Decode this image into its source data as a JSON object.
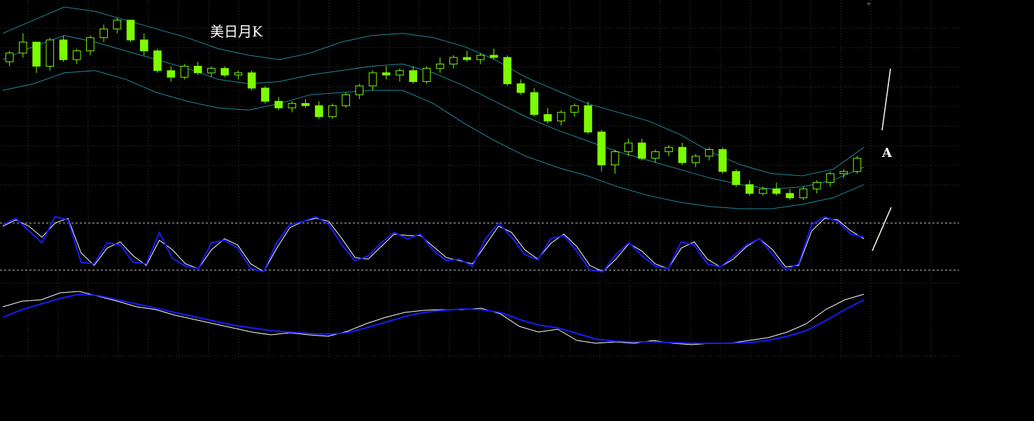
{
  "chart_data": {
    "type": "candlestick",
    "title": "美日月K",
    "annotation": "A",
    "grid": true,
    "colors": {
      "background": "#000000",
      "candle": "#7CFC00",
      "bollinger": "#1f8a9a",
      "fast_line": "#ffffff",
      "slow_line": "#1a1aff",
      "grid": "#3a3a3a",
      "annotation": "#ffffff"
    },
    "panels": [
      {
        "name": "",
        "type": "candlestick_bollinger",
        "ylim": [
          0,
          1
        ]
      },
      {
        "name": "",
        "type": "oscillator",
        "ylim": [
          0,
          100
        ],
        "reference_levels": [
          80,
          20
        ]
      },
      {
        "name": "",
        "type": "oscillator",
        "ylim": [
          0,
          100
        ]
      }
    ],
    "candles": [
      [
        0.35,
        0.4,
        0.33,
        0.39
      ],
      [
        0.39,
        0.48,
        0.37,
        0.44
      ],
      [
        0.44,
        0.42,
        0.3,
        0.33
      ],
      [
        0.33,
        0.46,
        0.31,
        0.45
      ],
      [
        0.45,
        0.47,
        0.35,
        0.36
      ],
      [
        0.36,
        0.41,
        0.34,
        0.4
      ],
      [
        0.4,
        0.47,
        0.38,
        0.46
      ],
      [
        0.46,
        0.52,
        0.44,
        0.5
      ],
      [
        0.5,
        0.55,
        0.48,
        0.54
      ],
      [
        0.54,
        0.53,
        0.44,
        0.45
      ],
      [
        0.45,
        0.48,
        0.38,
        0.4
      ],
      [
        0.4,
        0.41,
        0.3,
        0.31
      ],
      [
        0.31,
        0.33,
        0.26,
        0.28
      ],
      [
        0.28,
        0.34,
        0.27,
        0.33
      ],
      [
        0.33,
        0.35,
        0.29,
        0.3
      ],
      [
        0.3,
        0.33,
        0.28,
        0.32
      ],
      [
        0.32,
        0.33,
        0.28,
        0.29
      ],
      [
        0.29,
        0.31,
        0.27,
        0.3
      ],
      [
        0.3,
        0.31,
        0.22,
        0.23
      ],
      [
        0.23,
        0.24,
        0.16,
        0.17
      ],
      [
        0.17,
        0.19,
        0.13,
        0.14
      ],
      [
        0.14,
        0.17,
        0.12,
        0.16
      ],
      [
        0.16,
        0.18,
        0.14,
        0.15
      ],
      [
        0.15,
        0.17,
        0.09,
        0.1
      ],
      [
        0.1,
        0.16,
        0.09,
        0.15
      ],
      [
        0.15,
        0.21,
        0.14,
        0.2
      ],
      [
        0.2,
        0.25,
        0.18,
        0.24
      ],
      [
        0.24,
        0.31,
        0.22,
        0.3
      ],
      [
        0.3,
        0.33,
        0.27,
        0.29
      ],
      [
        0.29,
        0.32,
        0.26,
        0.31
      ],
      [
        0.31,
        0.33,
        0.25,
        0.26
      ],
      [
        0.26,
        0.33,
        0.25,
        0.32
      ],
      [
        0.32,
        0.37,
        0.3,
        0.34
      ],
      [
        0.34,
        0.38,
        0.32,
        0.37
      ],
      [
        0.37,
        0.4,
        0.35,
        0.36
      ],
      [
        0.36,
        0.39,
        0.34,
        0.38
      ],
      [
        0.38,
        0.41,
        0.36,
        0.37
      ],
      [
        0.37,
        0.38,
        0.24,
        0.25
      ],
      [
        0.25,
        0.27,
        0.2,
        0.21
      ],
      [
        0.21,
        0.23,
        0.1,
        0.11
      ],
      [
        0.11,
        0.14,
        0.07,
        0.08
      ],
      [
        0.08,
        0.13,
        0.06,
        0.12
      ],
      [
        0.12,
        0.16,
        0.1,
        0.15
      ],
      [
        0.15,
        0.17,
        0.02,
        0.03
      ],
      [
        0.03,
        0.04,
        -0.15,
        -0.12
      ],
      [
        -0.12,
        -0.05,
        -0.16,
        -0.06
      ],
      [
        -0.06,
        0.0,
        -0.08,
        -0.02
      ],
      [
        -0.02,
        0.0,
        -0.1,
        -0.09
      ],
      [
        -0.09,
        -0.05,
        -0.11,
        -0.06
      ],
      [
        -0.06,
        -0.03,
        -0.08,
        -0.04
      ],
      [
        -0.04,
        -0.02,
        -0.12,
        -0.11
      ],
      [
        -0.11,
        -0.07,
        -0.13,
        -0.08
      ],
      [
        -0.08,
        -0.04,
        -0.1,
        -0.05
      ],
      [
        -0.05,
        -0.04,
        -0.16,
        -0.15
      ],
      [
        -0.15,
        -0.14,
        -0.22,
        -0.21
      ],
      [
        -0.21,
        -0.19,
        -0.26,
        -0.25
      ],
      [
        -0.25,
        -0.22,
        -0.26,
        -0.23
      ],
      [
        -0.23,
        -0.2,
        -0.26,
        -0.25
      ],
      [
        -0.25,
        -0.23,
        -0.28,
        -0.27
      ],
      [
        -0.27,
        -0.22,
        -0.28,
        -0.23
      ],
      [
        -0.23,
        -0.19,
        -0.25,
        -0.2
      ],
      [
        -0.2,
        -0.15,
        -0.22,
        -0.16
      ],
      [
        -0.16,
        -0.14,
        -0.18,
        -0.15
      ],
      [
        -0.15,
        -0.08,
        -0.16,
        -0.09
      ]
    ],
    "bollinger": {
      "upper": [
        0.48,
        0.54,
        0.6,
        0.58,
        0.54,
        0.5,
        0.46,
        0.41,
        0.38,
        0.36,
        0.39,
        0.44,
        0.47,
        0.48,
        0.46,
        0.42,
        0.36,
        0.28,
        0.22,
        0.16,
        0.12,
        0.08,
        0.02,
        -0.06,
        -0.12,
        -0.16,
        -0.17,
        -0.14,
        -0.04
      ],
      "middle": [
        0.36,
        0.42,
        0.47,
        0.44,
        0.4,
        0.36,
        0.32,
        0.27,
        0.25,
        0.26,
        0.29,
        0.31,
        0.33,
        0.34,
        0.3,
        0.24,
        0.17,
        0.1,
        0.04,
        -0.01,
        -0.06,
        -0.1,
        -0.14,
        -0.18,
        -0.21,
        -0.23,
        -0.22,
        -0.19,
        -0.13
      ],
      "lower": [
        0.22,
        0.25,
        0.3,
        0.31,
        0.27,
        0.21,
        0.17,
        0.14,
        0.13,
        0.16,
        0.2,
        0.21,
        0.22,
        0.22,
        0.16,
        0.07,
        -0.01,
        -0.08,
        -0.13,
        -0.17,
        -0.22,
        -0.26,
        -0.29,
        -0.31,
        -0.32,
        -0.32,
        -0.3,
        -0.27,
        -0.21
      ]
    },
    "oscillator_fast": [
      78,
      86,
      70,
      55,
      88,
      84,
      30,
      28,
      55,
      52,
      30,
      28,
      68,
      35,
      25,
      22,
      55,
      58,
      48,
      22,
      18,
      55,
      78,
      82,
      88,
      78,
      52,
      32,
      38,
      55,
      68,
      60,
      66,
      45,
      32,
      34,
      25,
      60,
      80,
      62,
      40,
      33,
      60,
      64,
      44,
      20,
      18,
      40,
      55,
      38,
      25,
      22,
      56,
      52,
      28,
      24,
      38,
      52,
      60,
      40,
      20,
      28,
      78,
      88,
      82,
      66,
      62
    ],
    "oscillator_slow": [
      76,
      84,
      76,
      62,
      80,
      86,
      42,
      26,
      48,
      56,
      38,
      26,
      58,
      46,
      28,
      22,
      46,
      60,
      52,
      28,
      18,
      48,
      74,
      82,
      86,
      82,
      60,
      36,
      34,
      50,
      66,
      64,
      64,
      50,
      36,
      32,
      28,
      52,
      76,
      68,
      46,
      34,
      54,
      66,
      50,
      26,
      18,
      34,
      54,
      44,
      28,
      22,
      48,
      56,
      34,
      24,
      34,
      50,
      60,
      46,
      24,
      26,
      70,
      86,
      84,
      70,
      60
    ],
    "trend_fast": [
      70,
      78,
      80,
      90,
      92,
      85,
      78,
      70,
      66,
      58,
      52,
      46,
      40,
      34,
      30,
      33,
      30,
      28,
      35,
      46,
      55,
      62,
      65,
      66,
      66,
      68,
      60,
      42,
      34,
      38,
      22,
      18,
      20,
      18,
      22,
      18,
      16,
      18,
      18,
      22,
      26,
      34,
      46,
      66,
      80,
      88
    ],
    "trend_slow": [
      55,
      66,
      74,
      82,
      88,
      86,
      80,
      74,
      68,
      62,
      56,
      50,
      44,
      40,
      36,
      34,
      32,
      31,
      33,
      40,
      48,
      56,
      62,
      65,
      67,
      66,
      62,
      52,
      44,
      40,
      32,
      24,
      21,
      20,
      20,
      19,
      18,
      18,
      18,
      19,
      22,
      28,
      36,
      50,
      66,
      80
    ]
  }
}
